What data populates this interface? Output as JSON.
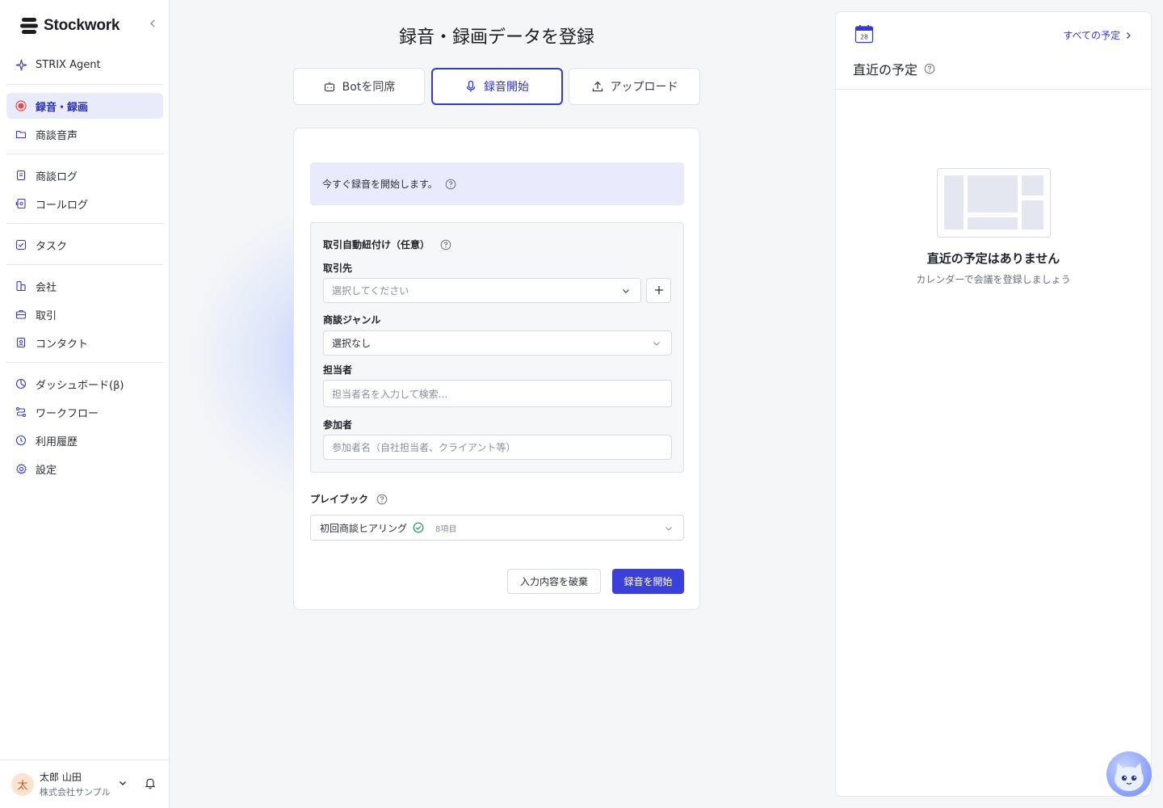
{
  "sidebar": {
    "logo_text": "Stockwork",
    "collapse_icon": "chevron-left-icon",
    "items": [
      {
        "label": "STRIX Agent",
        "icon": "sparkle-icon"
      },
      {
        "label": "録音・録画",
        "icon": "record-icon",
        "active": true
      },
      {
        "label": "商談音声",
        "icon": "folder-icon"
      },
      {
        "label": "商談ログ",
        "icon": "document-icon"
      },
      {
        "label": "コールログ",
        "icon": "call-log-icon"
      },
      {
        "label": "タスク",
        "icon": "task-check-icon"
      },
      {
        "label": "会社",
        "icon": "building-icon"
      },
      {
        "label": "取引",
        "icon": "briefcase-icon"
      },
      {
        "label": "コンタクト",
        "icon": "contact-icon"
      },
      {
        "label": "ダッシュボード(β)",
        "icon": "chart-icon"
      },
      {
        "label": "ワークフロー",
        "icon": "workflow-icon"
      },
      {
        "label": "利用履歴",
        "icon": "history-icon"
      },
      {
        "label": "設定",
        "icon": "gear-icon"
      }
    ],
    "user": {
      "avatar_char": "太",
      "name": "太郎 山田",
      "company": "株式会社サンプル"
    }
  },
  "main": {
    "title": "録音・録画データを登録",
    "tabs": [
      {
        "label": "Botを同席",
        "icon": "bot-icon"
      },
      {
        "label": "録音開始",
        "icon": "microphone-icon",
        "active": true
      },
      {
        "label": "アップロード",
        "icon": "upload-icon"
      }
    ],
    "info_text": "今すぐ録音を開始します。",
    "association": {
      "title": "取引自動紐付け（任意）",
      "client_label": "取引先",
      "client_placeholder": "選択してください",
      "genre_label": "商談ジャンル",
      "genre_value": "選択なし",
      "owner_label": "担当者",
      "owner_placeholder": "担当者名を入力して検索...",
      "participants_label": "参加者",
      "participants_placeholder": "参加者名（自社担当者、クライアント等）"
    },
    "playbook": {
      "label": "プレイブック",
      "value": "初回商談ヒアリング",
      "count": "8項目"
    },
    "buttons": {
      "discard": "入力内容を破棄",
      "start": "録音を開始"
    }
  },
  "right_panel": {
    "calendar_day": "28",
    "all_link": "すべての予定",
    "title": "直近の予定",
    "empty_title": "直近の予定はありません",
    "empty_sub": "カレンダーで会議を登録しましょう"
  },
  "colors": {
    "accent": "#3b40d9",
    "active_bg": "#e9ebfb",
    "info_bg": "#e9eafb",
    "record_red": "#e5483f"
  }
}
